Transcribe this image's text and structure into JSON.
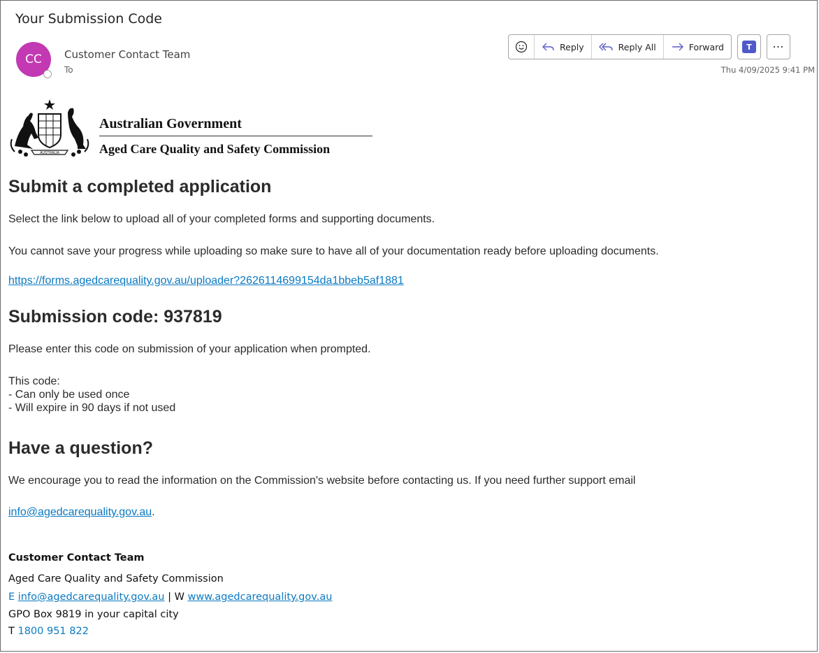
{
  "email": {
    "subject": "Your Submission Code",
    "avatar_initials": "CC",
    "sender": "Customer Contact Team",
    "to_label": "To",
    "timestamp": "Thu 4/09/2025 9:41 PM"
  },
  "toolbar": {
    "reply": "Reply",
    "reply_all": "Reply All",
    "forward": "Forward"
  },
  "body": {
    "gov_name": "Australian Government",
    "agency": "Aged Care Quality and Safety Commission",
    "logo_text": "AUSTRALIA",
    "heading1": "Submit a completed application",
    "para1": "Select the link below to upload all of your completed forms and supporting documents.",
    "para2": "You cannot save your progress while uploading so make sure to have all of your documentation ready before uploading documents.",
    "upload_link": "https://forms.agedcarequality.gov.au/uploader?2626114699154da1bbeb5af1881",
    "heading2": "Submission code: 937819",
    "para3": "Please enter this code on submission of your application when prompted.",
    "code_intro": "This code:",
    "code_rule1": "- Can only be used once",
    "code_rule2": "- Will expire in 90 days if not used",
    "heading3": "Have a question?",
    "para4": "We encourage you to read the information on the Commission's website before contacting us. If you need further support email",
    "support_email": "info@agedcarequality.gov.au",
    "support_email_suffix": "."
  },
  "signature": {
    "team": "Customer Contact Team",
    "org": "Aged Care Quality and Safety Commission",
    "email_prefix": "E",
    "email": "info@agedcarequality.gov.au",
    "separator": "| W",
    "website": "www.agedcarequality.gov.au",
    "address": "GPO Box 9819 in your capital city",
    "phone_prefix": "T",
    "phone": "1800 951 822"
  },
  "colors": {
    "avatar": "#c239b3",
    "link": "#0b7ac2",
    "toolbar_icon": "#5b5fc7"
  },
  "icons": [
    "emoji-icon",
    "reply-icon",
    "reply-all-icon",
    "forward-icon",
    "teams-icon",
    "more-icon",
    "coat-of-arms-icon"
  ]
}
